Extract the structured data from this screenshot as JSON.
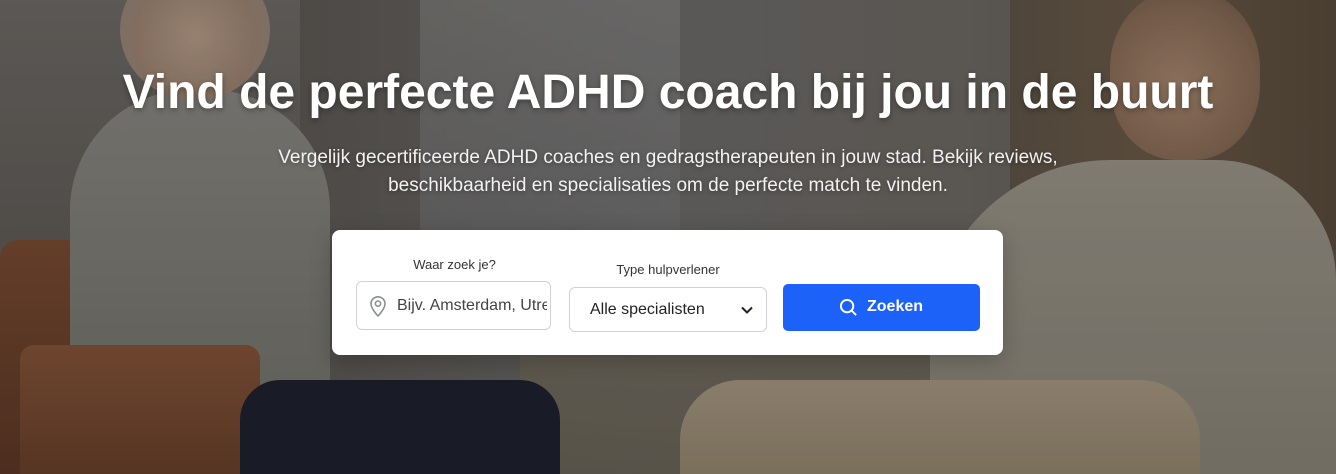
{
  "hero": {
    "title": "Vind de perfecte ADHD coach bij jou in de buurt",
    "subtitle": "Vergelijk gecertificeerde ADHD coaches en gedragstherapeuten in jouw stad. Bekijk reviews, beschikbaarheid en specialisaties om de perfecte match te vinden."
  },
  "search": {
    "location_label": "Waar zoek je?",
    "location_placeholder": "Bijv. Amsterdam, Utrecht",
    "location_icon": "map-pin-icon",
    "type_label": "Type hulpverlener",
    "type_selected": "Alle specialisten",
    "type_icon": "chevron-down-icon",
    "button_label": "Zoeken",
    "button_icon": "search-icon",
    "button_color": "#1c62f8"
  }
}
